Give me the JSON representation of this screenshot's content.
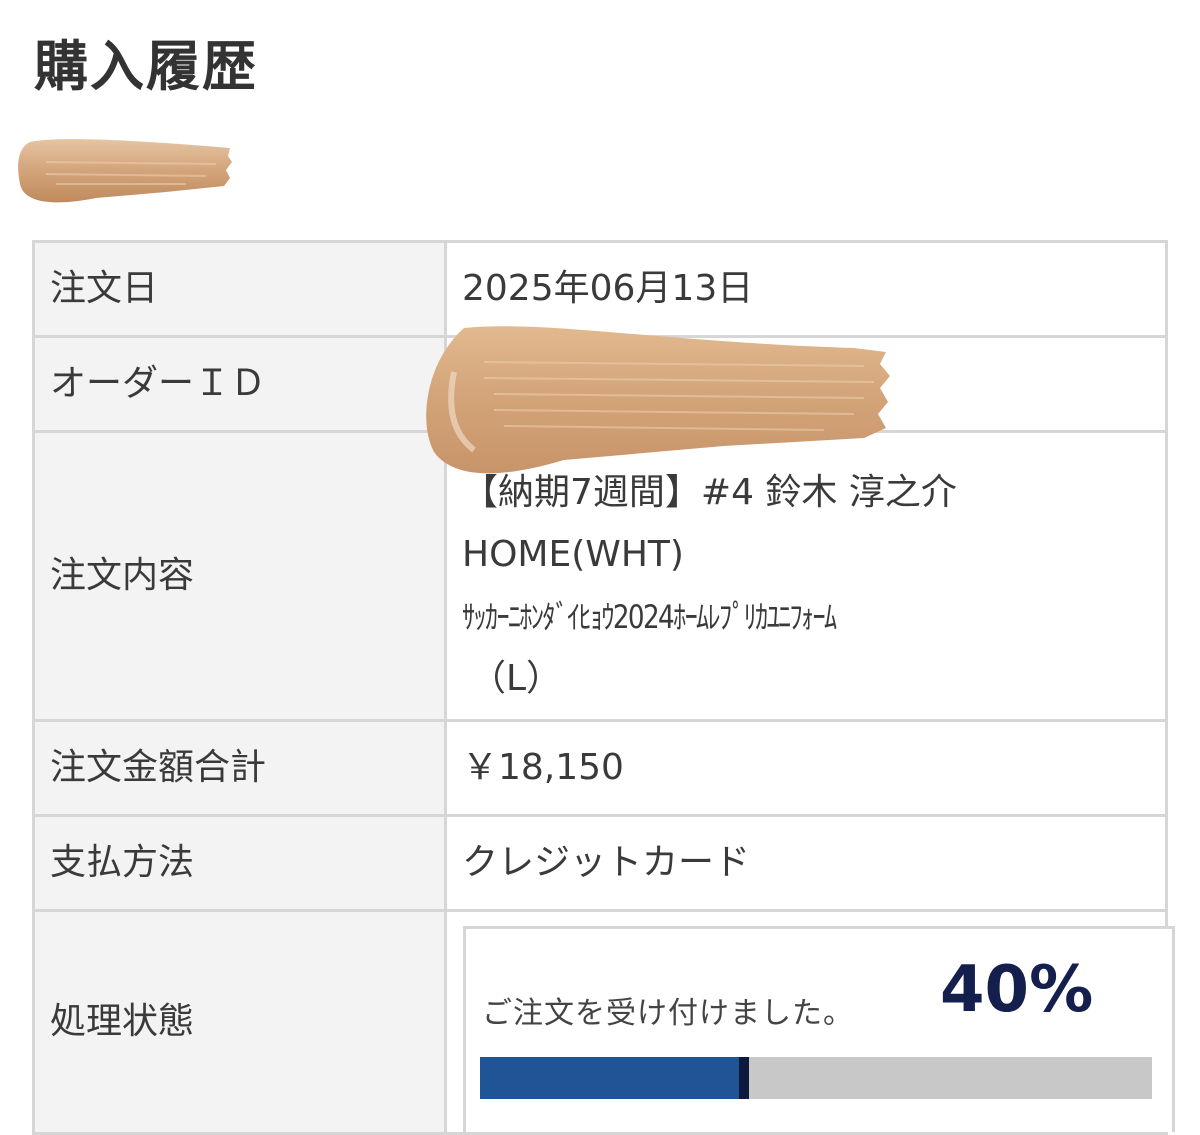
{
  "page": {
    "title": "購入履歴"
  },
  "order": {
    "rows": {
      "date": {
        "label": "注文日",
        "value": "2025年06月13日"
      },
      "order_id": {
        "label": "オーダーＩＤ",
        "value": ""
      },
      "content": {
        "label": "注文内容",
        "line1": "【納期7週間】#4 鈴木 淳之介",
        "line2": "HOME(WHT)",
        "line3": "ｻｯｶｰﾆﾎﾝﾀﾞｲﾋｮｳ2024ﾎｰﾑﾚﾌﾟﾘｶﾕﾆﾌｫｰﾑ",
        "line4": "（L）"
      },
      "total": {
        "label": "注文金額合計",
        "value": "￥18,150"
      },
      "payment": {
        "label": "支払方法",
        "value": "クレジットカード"
      },
      "status": {
        "label": "処理状態",
        "message": "ご注文を受け付けました。",
        "percent_text": "40%",
        "progress": 0.4
      }
    }
  },
  "colors": {
    "progress_fill": "#1f5596",
    "progress_track": "#c8c8c8",
    "percent_text": "#141f4d",
    "redaction": "#d4a47a"
  }
}
